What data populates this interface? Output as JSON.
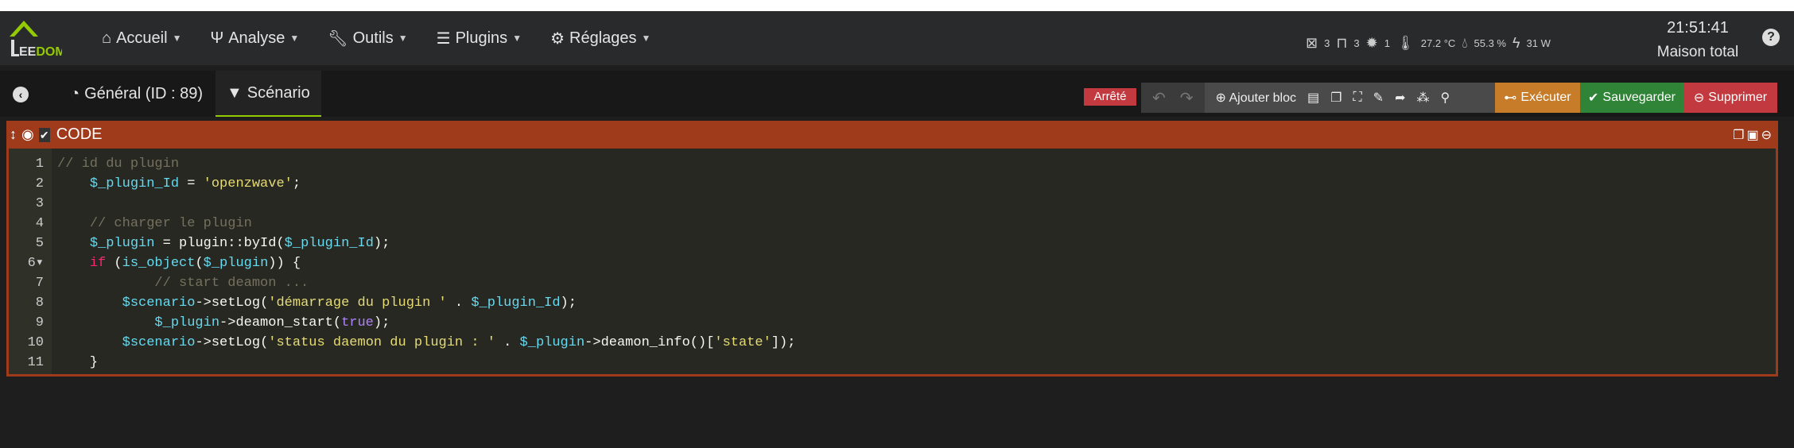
{
  "logo": {
    "text": "EEDOM"
  },
  "nav": {
    "items": [
      {
        "label": "Accueil",
        "icon": "home-icon"
      },
      {
        "label": "Analyse",
        "icon": "stethoscope-icon"
      },
      {
        "label": "Outils",
        "icon": "wrench-icon"
      },
      {
        "label": "Plugins",
        "icon": "tasks-icon"
      },
      {
        "label": "Réglages",
        "icon": "gear-icon"
      }
    ]
  },
  "status": {
    "openings": "3",
    "shutters": "3",
    "lights": "1",
    "temperature": "27.2 °C",
    "humidity": "55.3 %",
    "power": "31 W"
  },
  "clock": {
    "time": "21:51:41",
    "location": "Maison total"
  },
  "tabs": {
    "general": "Général (ID : 89)",
    "scenario": "Scénario"
  },
  "toolbar": {
    "state": "Arrêté",
    "add_block": "Ajouter bloc",
    "execute": "Exécuter",
    "save": "Sauvegarder",
    "delete": "Supprimer"
  },
  "colors": {
    "execute": "#c67c28",
    "save": "#308437",
    "delete": "#c23a3f",
    "block": "#9f3a1b"
  },
  "block": {
    "title": "CODE",
    "lines": [
      [
        [
          "c",
          "// id du plugin"
        ]
      ],
      [
        [
          "p",
          "    "
        ],
        [
          "v",
          "$_plugin_Id"
        ],
        [
          "p",
          " = "
        ],
        [
          "s",
          "'openzwave'"
        ],
        [
          "p",
          ";"
        ]
      ],
      [
        [
          "p",
          ""
        ]
      ],
      [
        [
          "p",
          "    "
        ],
        [
          "c",
          "// charger le plugin"
        ]
      ],
      [
        [
          "p",
          "    "
        ],
        [
          "v",
          "$_plugin"
        ],
        [
          "p",
          " = plugin::byId("
        ],
        [
          "v",
          "$_plugin_Id"
        ],
        [
          "p",
          ");"
        ]
      ],
      [
        [
          "p",
          "    "
        ],
        [
          "k",
          "if"
        ],
        [
          "p",
          " ("
        ],
        [
          "v",
          "is_object"
        ],
        [
          "p",
          "("
        ],
        [
          "v",
          "$_plugin"
        ],
        [
          "p",
          ")) {"
        ]
      ],
      [
        [
          "p",
          "            "
        ],
        [
          "c",
          "// start deamon ..."
        ]
      ],
      [
        [
          "p",
          "        "
        ],
        [
          "v",
          "$scenario"
        ],
        [
          "p",
          "->setLog("
        ],
        [
          "s",
          "'démarrage du plugin '"
        ],
        [
          "p",
          " . "
        ],
        [
          "v",
          "$_plugin_Id"
        ],
        [
          "p",
          ");"
        ]
      ],
      [
        [
          "p",
          "            "
        ],
        [
          "v",
          "$_plugin"
        ],
        [
          "p",
          "->deamon_start("
        ],
        [
          "b",
          "true"
        ],
        [
          "p",
          ");"
        ]
      ],
      [
        [
          "p",
          "        "
        ],
        [
          "v",
          "$scenario"
        ],
        [
          "p",
          "->setLog("
        ],
        [
          "s",
          "'status daemon du plugin : '"
        ],
        [
          "p",
          " . "
        ],
        [
          "v",
          "$_plugin"
        ],
        [
          "p",
          "->deamon_info()["
        ],
        [
          "s",
          "'state'"
        ],
        [
          "p",
          "]);"
        ]
      ],
      [
        [
          "p",
          "    }"
        ]
      ]
    ],
    "line_numbers": [
      "1",
      "2",
      "3",
      "4",
      "5",
      "6▾",
      "7",
      "8",
      "9",
      "10",
      "11"
    ]
  }
}
